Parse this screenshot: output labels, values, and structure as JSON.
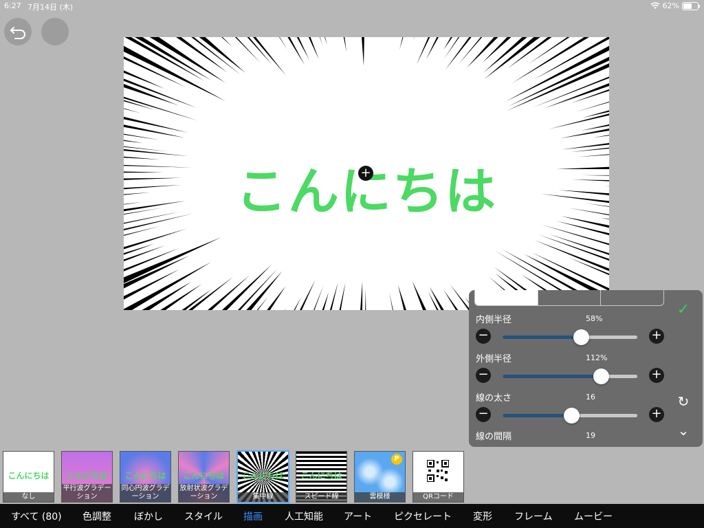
{
  "status": {
    "time": "6:27",
    "date": "7月14日 (木)",
    "battery_pct": "62%",
    "battery_level": 0.62
  },
  "toolbar": {
    "undo_icon": "undo-icon",
    "redo_icon": "redo-icon"
  },
  "canvas": {
    "text": "こんにちは",
    "text_color": "#4cd964",
    "center_handle_icon": "plus"
  },
  "panel": {
    "params": [
      {
        "label": "内側半径",
        "value": "58%",
        "level": 0.58
      },
      {
        "label": "外側半径",
        "value": "112%",
        "level": 0.73
      },
      {
        "label": "線の太さ",
        "value": "16",
        "level": 0.51
      },
      {
        "label": "線の間隔",
        "value": "19"
      }
    ],
    "minus_symbol": "−",
    "plus_symbol": "+",
    "confirm_icon": "✓",
    "reset_icon": "↻",
    "collapse_icon": "⌄"
  },
  "effects": [
    {
      "label": "なし",
      "thumb_text": "こんにちは"
    },
    {
      "label": "平行波グラデーション",
      "thumb_text": "こんにちは"
    },
    {
      "label": "同心円波グラデーション",
      "thumb_text": "こんにちは"
    },
    {
      "label": "放射状波グラデーション",
      "thumb_text": "こんにちは"
    },
    {
      "label": "集中線",
      "thumb_text": "こんにちは",
      "selected": true
    },
    {
      "label": "スピード線",
      "thumb_text": "こんにちは"
    },
    {
      "label": "雲模様",
      "badge": "P"
    },
    {
      "label": "QRコード"
    }
  ],
  "tabs": [
    "すべて (80)",
    "色調整",
    "ぼかし",
    "スタイル",
    "描画",
    "人工知能",
    "アート",
    "ピクセレート",
    "変形",
    "フレーム",
    "ムービー"
  ],
  "active_tab": "描画",
  "colors": {
    "accent": "#3c8cff",
    "confirm": "#2ed158",
    "slider_fill": "#26527a"
  }
}
